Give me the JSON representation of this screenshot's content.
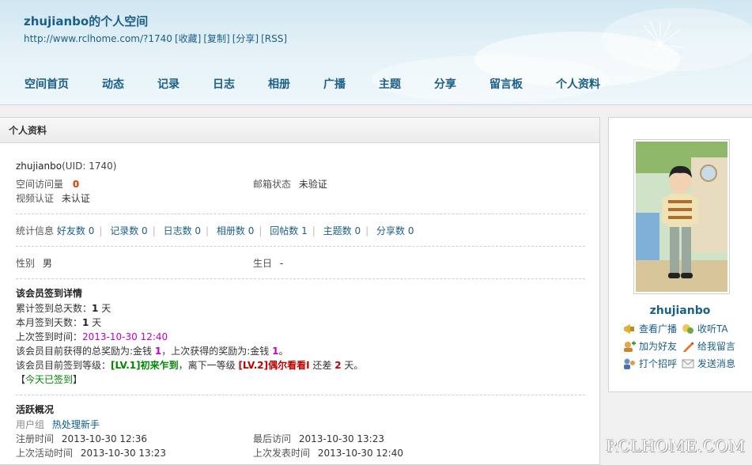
{
  "header": {
    "title": "zhujianbo的个人空间",
    "url": "http://www.rclhome.com/?1740",
    "links": [
      "[收藏]",
      "[复制]",
      "[分享]",
      "[RSS]"
    ]
  },
  "nav": [
    "空间首页",
    "动态",
    "记录",
    "日志",
    "相册",
    "广播",
    "主题",
    "分享",
    "留言板",
    "个人资料"
  ],
  "panel": {
    "title": "个人资料",
    "username": "zhujianbo",
    "uid": "(UID: 1740)",
    "visits_label": "空间访问量",
    "visits_value": "0",
    "email_label": "邮箱状态",
    "email_value": "未验证",
    "video_label": "视频认证",
    "video_value": "未认证",
    "stats_label": "统计信息",
    "stats": [
      {
        "label": "好友数",
        "value": "0"
      },
      {
        "label": "记录数",
        "value": "0"
      },
      {
        "label": "日志数",
        "value": "0"
      },
      {
        "label": "相册数",
        "value": "0"
      },
      {
        "label": "回帖数",
        "value": "1"
      },
      {
        "label": "主题数",
        "value": "0"
      },
      {
        "label": "分享数",
        "value": "0"
      }
    ],
    "gender_label": "性别",
    "gender_value": "男",
    "birthday_label": "生日",
    "birthday_value": "-"
  },
  "signin": {
    "title": "该会员签到详情",
    "total_label": "累计签到总天数：",
    "total_value": "1",
    "month_label": "本月签到天数：",
    "month_value": "1",
    "day_unit": "天",
    "last_label": "上次签到时间：",
    "last_value": "2013-10-30 12:40",
    "reward_prefix": "该会员目前获得的总奖励为:金钱",
    "reward_total": "1",
    "reward_mid": "，上次获得的奖励为:金钱",
    "reward_last": "1",
    "reward_end": "。",
    "level_prefix": "该会员目前签到等级：",
    "level_current": "[LV.1]初来乍到",
    "level_mid": "，离下一等级",
    "level_next": "[LV.2]偶尔看看I",
    "level_gap_prefix": "还差",
    "level_gap": "2",
    "level_gap_suffix": "天。",
    "today_bracket_open": "【",
    "today_status": "今天已签到",
    "today_bracket_close": "】"
  },
  "activity": {
    "title": "活跃概况",
    "group_label": "用户组",
    "group_value": "热处理新手",
    "reg_label": "注册时间",
    "reg_value": "2013-10-30 12:36",
    "lastvisit_label": "最后访问",
    "lastvisit_value": "2013-10-30 13:23",
    "lastactive_label": "上次活动时间",
    "lastactive_value": "2013-10-30 13:23",
    "lastpost_label": "上次发表时间",
    "lastpost_value": "2013-10-30 12:40"
  },
  "side": {
    "name": "zhujianbo",
    "actions": [
      "查看广播",
      "收听TA",
      "加为好友",
      "给我留言",
      "打个招呼",
      "发送消息"
    ]
  },
  "watermark": "RCLHOME.COM"
}
